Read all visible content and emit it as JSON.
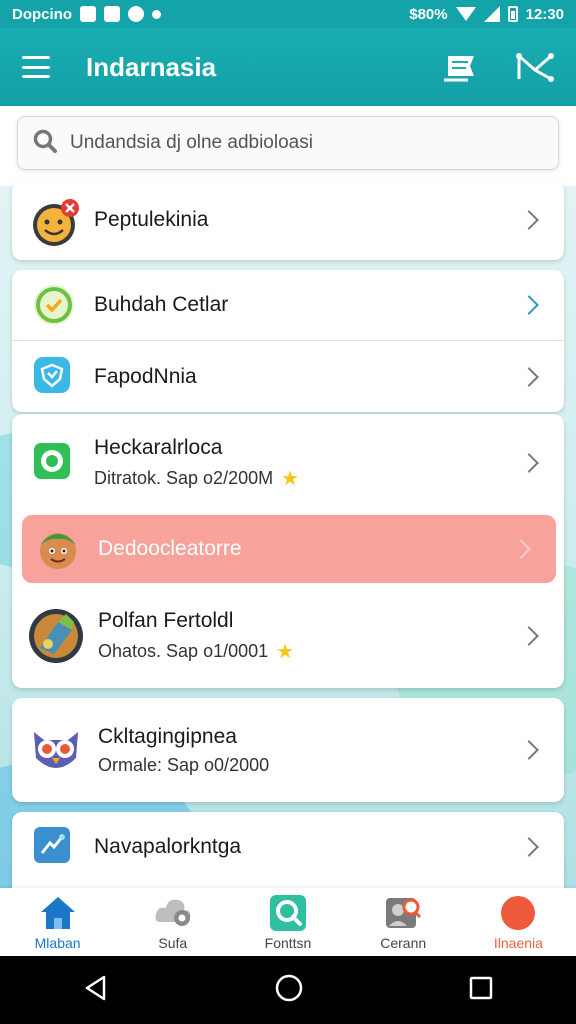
{
  "status_bar": {
    "carrier": "Dopcino",
    "battery_text": "$80%",
    "time": "12:30"
  },
  "app_bar": {
    "title": "Indarnasia",
    "menu_icon": "hamburger-icon",
    "action_icons": [
      "flag-icon",
      "share-icon"
    ]
  },
  "search": {
    "placeholder": "Undandsia dj olne adbioloasi"
  },
  "list": [
    {
      "title": "Peptulekinia",
      "icon": "smiley-badge-icon"
    },
    {
      "title": "Buhdah Cetlar",
      "icon": "green-chat-icon"
    },
    {
      "title": "FapodNnia",
      "icon": "blue-shield-icon"
    },
    {
      "title": "Heckaralrloca",
      "subtitle": "Ditratok. Sap o2/200M",
      "icon": "green-camera-icon",
      "rated": true
    },
    {
      "title": "Dedoocleatorre",
      "icon": "cartoon-face-icon",
      "highlighted": true
    },
    {
      "title": "Polfan Fertoldl",
      "subtitle": "Ohatos. Sap o1/0001",
      "icon": "game-art-icon",
      "rated": true
    },
    {
      "title": "Ckltagingipnea",
      "subtitle": "Ormale: Sap o0/2000",
      "icon": "owl-icon"
    },
    {
      "title": "Navapalorkntga",
      "icon": "blue-puzzle-icon"
    }
  ],
  "bottom_nav": [
    {
      "label": "Mlaban",
      "icon": "home-icon",
      "active": true
    },
    {
      "label": "Sufa",
      "icon": "cloud-gear-icon"
    },
    {
      "label": "Fonttsn",
      "icon": "search-icon"
    },
    {
      "label": "Cerann",
      "icon": "profile-search-icon"
    },
    {
      "label": "Ilnaenia",
      "icon": "red-dot-icon",
      "alert": true
    }
  ],
  "colors": {
    "primary": "#139fa5",
    "highlight": "#f8a29c",
    "star": "#f5c518",
    "active_nav": "#1b77c8",
    "alert_nav": "#e8643f"
  }
}
